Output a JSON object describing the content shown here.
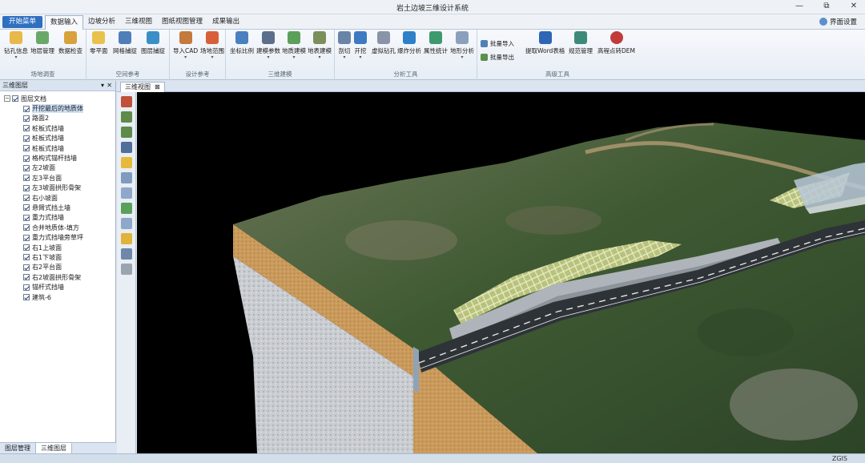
{
  "window": {
    "title": "岩土边坡三维设计系统",
    "minimize": "—",
    "restore": "⧉",
    "close": "✕"
  },
  "menubar": {
    "start": "开始菜单",
    "tabs": [
      "数据输入",
      "边坡分析",
      "三维视图",
      "图纸视图管理",
      "成果输出"
    ],
    "active_tab": "数据输入",
    "settings": "界面设置"
  },
  "ribbon": {
    "groups": [
      {
        "label": "场地调查",
        "tools": [
          "钻孔信息",
          "地层管理",
          "数据检查"
        ]
      },
      {
        "label": "空间参考",
        "tools": [
          "零平面",
          "网格捕捉",
          "图层捕捉"
        ]
      },
      {
        "label": "设计参考",
        "tools": [
          "导入CAD",
          "场地范围"
        ]
      },
      {
        "label": "三维建模",
        "tools": [
          "坐标比例",
          "建模参数",
          "地质建模",
          "地表建模"
        ]
      },
      {
        "label": "分析工具",
        "tools": [
          "剖切",
          "开挖",
          "虚拟钻孔",
          "爆炸分析",
          "属性统计",
          "地形分析"
        ]
      },
      {
        "label": "高级工具",
        "small_tools": [
          "批量导入",
          "批量导出"
        ],
        "tools": [
          "提取Word表格",
          "规范管理",
          "高程点转DEM"
        ]
      }
    ]
  },
  "left_panel": {
    "title": "三维图层",
    "root": "图层文档",
    "items": [
      "开挖最后的地质体",
      "路面2",
      "桩板式挡墙",
      "桩板式挡墙",
      "桩板式挡墙",
      "格构式锚杆挡墙",
      "左2坡面",
      "左3平台面",
      "左3坡面拱形骨架",
      "右小坡面",
      "悬臂式挡土墙",
      "重力式挡墙",
      "合并地质体-填方",
      "重力式挡墙旁草坪",
      "右1上坡面",
      "右1下坡面",
      "右2平台面",
      "右2坡面拱形骨架",
      "锚杆式挡墙",
      "建筑-6"
    ],
    "bottom_tabs": [
      "图层管理",
      "三维图层"
    ]
  },
  "view": {
    "tab_label": "三维视图",
    "tab_close": "⊠"
  },
  "status": {
    "text": "ZGIS"
  },
  "colors": {
    "accent": "#2f6fc0",
    "terrain": "#3f5a33",
    "soil": "#c99a5b",
    "rock": "#c9ccd0",
    "road": "#2e3338"
  }
}
